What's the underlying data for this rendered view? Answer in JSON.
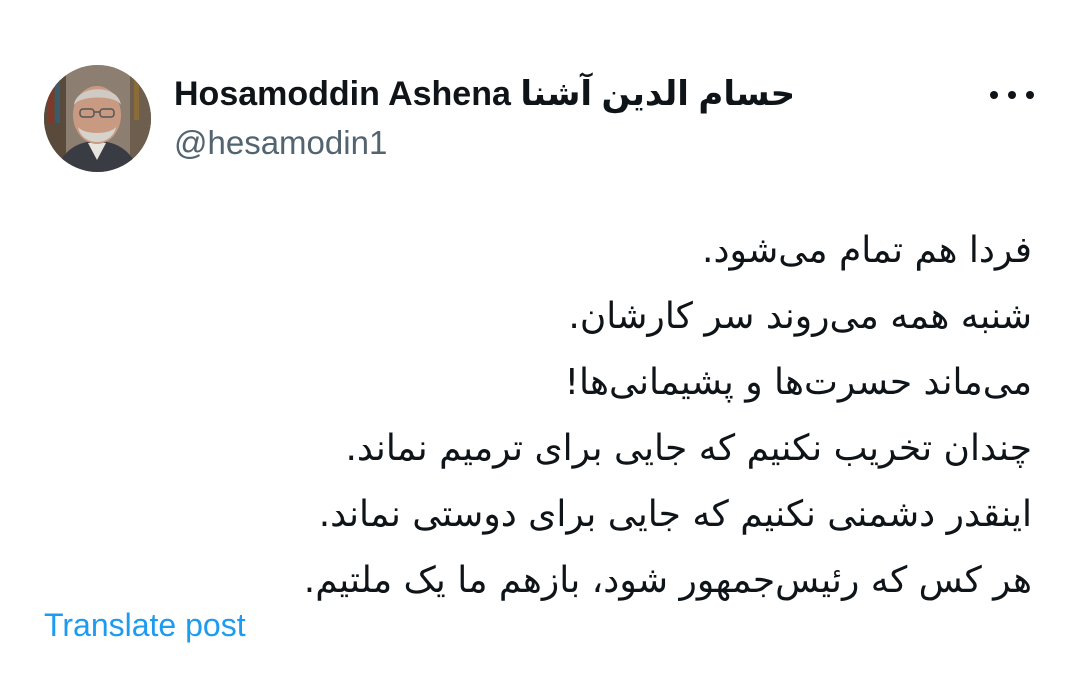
{
  "author": {
    "display_name": "Hosamoddin Ashena حسام الدين آشنا",
    "handle": "@hesamodin1",
    "avatar_icon": "person-photo-icon"
  },
  "menu": {
    "icon": "more-horizontal-icon"
  },
  "tweet": {
    "lines": [
      "فردا هم تمام می‌شود.",
      "شنبه همه می‌روند سر کارشان.",
      "می‌ماند حسرت‌ها و پشیمانی‌ها!",
      "چندان تخریب نکنیم که جایی برای ترمیم نماند.",
      "اینقدر دشمنی نکنیم که جایی برای دوستی نماند.",
      "هر کس که رئیس‌جمهور شود، بازهم ما یک ملتیم."
    ]
  },
  "actions": {
    "translate_label": "Translate post"
  },
  "colors": {
    "text": "#0f1419",
    "secondary": "#536471",
    "link": "#1d9bf0"
  }
}
